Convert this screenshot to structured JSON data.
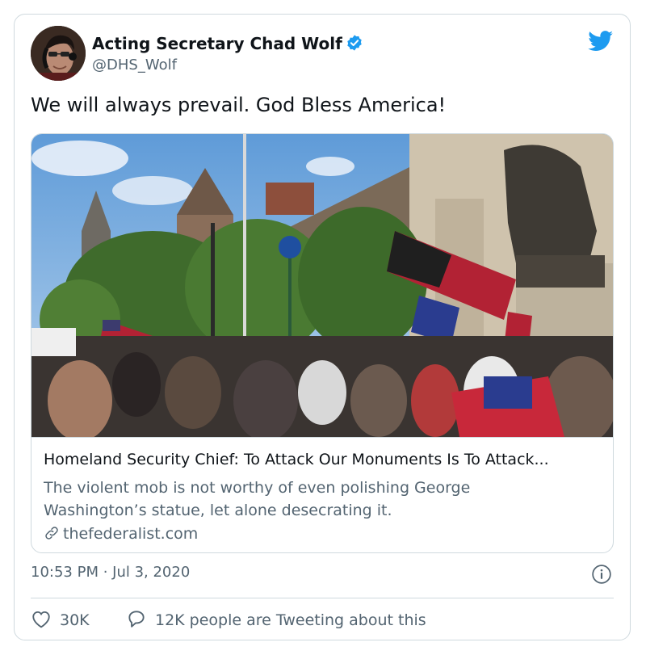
{
  "tweet": {
    "author_name": "Acting Secretary Chad Wolf",
    "handle": "@DHS_Wolf",
    "text": "We will always prevail. God Bless America!",
    "timestamp": "10:53 PM · Jul 3, 2020"
  },
  "link_card": {
    "title": "Homeland Security Chief: To Attack Our Monuments Is To Attack...",
    "description": "The violent mob is not worthy of even polishing George Washington’s statue, let alone desecrating it.",
    "domain": "thefederalist.com"
  },
  "actions": {
    "likes": "30K",
    "conversation": "12K people are Tweeting about this"
  },
  "icons": {
    "brand": "twitter-bird-icon",
    "verified": "verified-badge-icon",
    "link": "link-icon",
    "info": "info-icon",
    "like": "heart-icon",
    "reply": "speech-bubble-icon"
  },
  "colors": {
    "brand_blue": "#1d9bf0",
    "text_primary": "#0f1419",
    "text_secondary": "#536471",
    "border": "#cfd9de"
  }
}
